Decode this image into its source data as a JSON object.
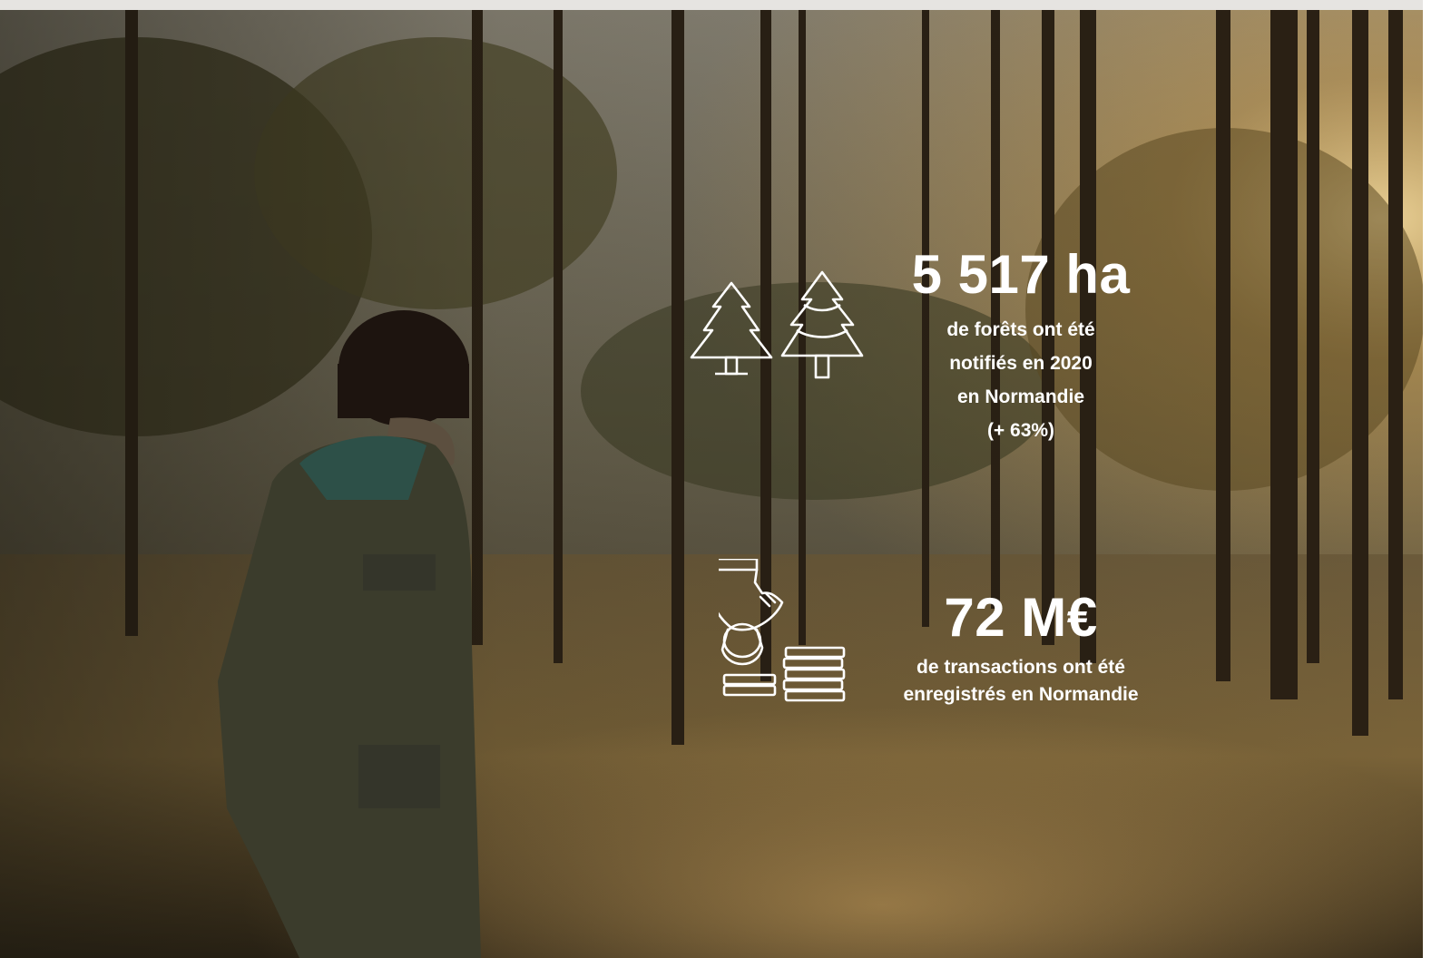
{
  "stats": [
    {
      "icon": "pine-trees-icon",
      "value": "5 517 ha",
      "lines": [
        "de forêts ont été",
        "notifiés en 2020",
        "en Normandie",
        "(+ 63%)"
      ]
    },
    {
      "icon": "coins-hand-icon",
      "value": "72 M€",
      "lines": [
        "de transactions ont été",
        "enregistrés en Normandie"
      ]
    }
  ],
  "colors": {
    "text": "#ffffff",
    "page_bg": "#e6e4e1"
  }
}
